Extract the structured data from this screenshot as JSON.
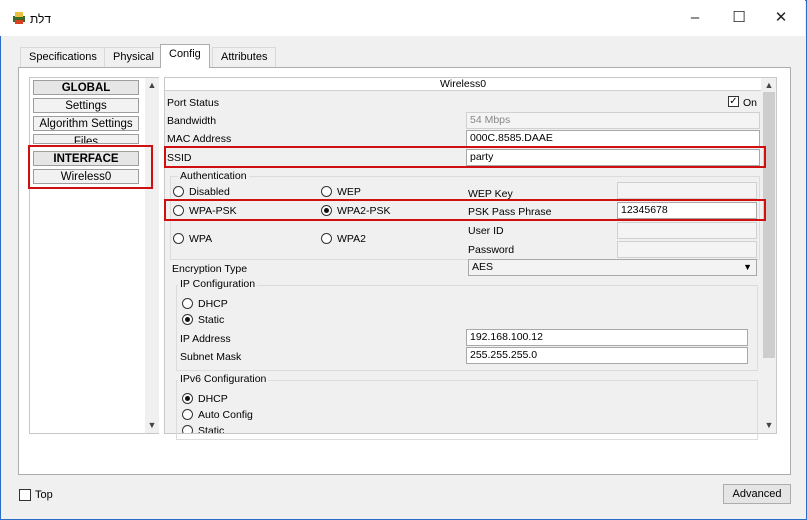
{
  "window": {
    "title": "דלת",
    "icon": "printer-icon",
    "controls": [
      "–",
      "☐",
      "✕"
    ]
  },
  "tabs": [
    {
      "label": "Specifications"
    },
    {
      "label": "Physical"
    },
    {
      "label": "Config"
    },
    {
      "label": "Attributes"
    }
  ],
  "sidebar": {
    "items": [
      {
        "label": "GLOBAL"
      },
      {
        "label": "Settings"
      },
      {
        "label": "Algorithm Settings"
      },
      {
        "label": "Files"
      },
      {
        "label": "INTERFACE"
      },
      {
        "label": "Wireless0"
      }
    ]
  },
  "wireless": {
    "header": "Wireless0",
    "port_status_label": "Port Status",
    "port_status_value": "On",
    "bandwidth_label": "Bandwidth",
    "bandwidth_value": "54 Mbps",
    "mac_label": "MAC Address",
    "mac_value": "000C.8585.DAAE",
    "ssid_label": "SSID",
    "ssid_value": "party",
    "auth": {
      "legend": "Authentication",
      "disabled": "Disabled",
      "wep": "WEP",
      "wpa_psk": "WPA-PSK",
      "wpa2_psk": "WPA2-PSK",
      "wpa": "WPA",
      "wpa2": "WPA2",
      "wep_key_label": "WEP Key",
      "psk_label": "PSK Pass Phrase",
      "psk_value": "12345678",
      "user_id_label": "User ID",
      "password_label": "Password"
    },
    "encryption_label": "Encryption Type",
    "encryption_value": "AES",
    "ip": {
      "legend": "IP Configuration",
      "dhcp": "DHCP",
      "static": "Static",
      "ip_label": "IP Address",
      "ip_value": "192.168.100.12",
      "mask_label": "Subnet Mask",
      "mask_value": "255.255.255.0"
    },
    "ipv6": {
      "legend": "IPv6 Configuration",
      "dhcp": "DHCP",
      "auto": "Auto Config",
      "static": "Static"
    }
  },
  "footer": {
    "top_label": "Top",
    "advanced_label": "Advanced"
  },
  "colors": {
    "highlight": "#d01010",
    "window_border": "#2b6cc4"
  }
}
